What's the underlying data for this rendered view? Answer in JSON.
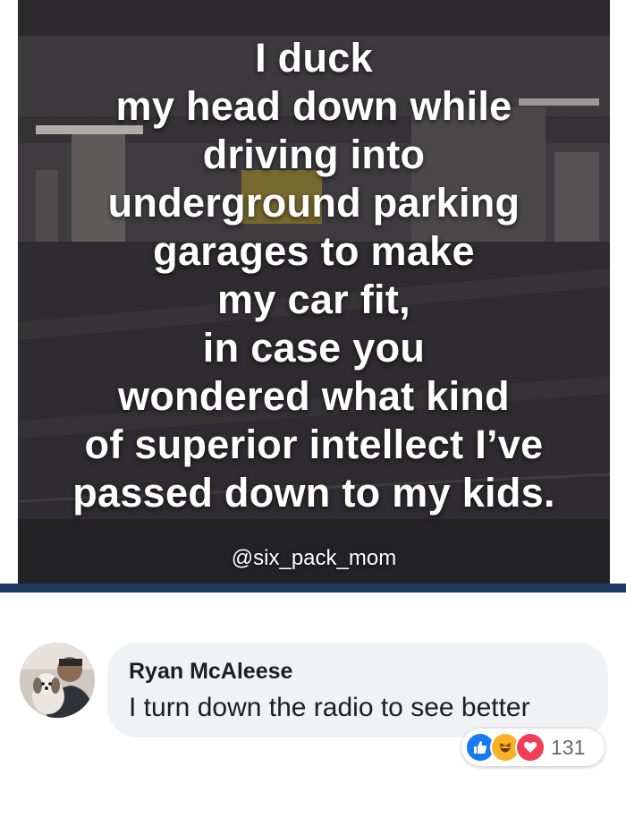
{
  "post": {
    "meme": {
      "text_lines": [
        "I duck",
        "my head down while",
        "driving into",
        "underground parking",
        "garages to make",
        "my car fit,",
        "in case you",
        "wondered what kind",
        "of superior intellect I’ve",
        "passed down to my kids."
      ],
      "watermark": "@six_pack_mom"
    }
  },
  "comment": {
    "author": "Ryan McAleese",
    "text": "I turn down the radio to see better",
    "reactions": {
      "icons": [
        "like-icon",
        "haha-icon",
        "love-icon"
      ],
      "count": "131"
    }
  },
  "colors": {
    "divider": "#1d3a63",
    "bubble": "#f0f2f5",
    "like": "#1877f2",
    "haha": "#f7b125",
    "love": "#f33e58"
  }
}
